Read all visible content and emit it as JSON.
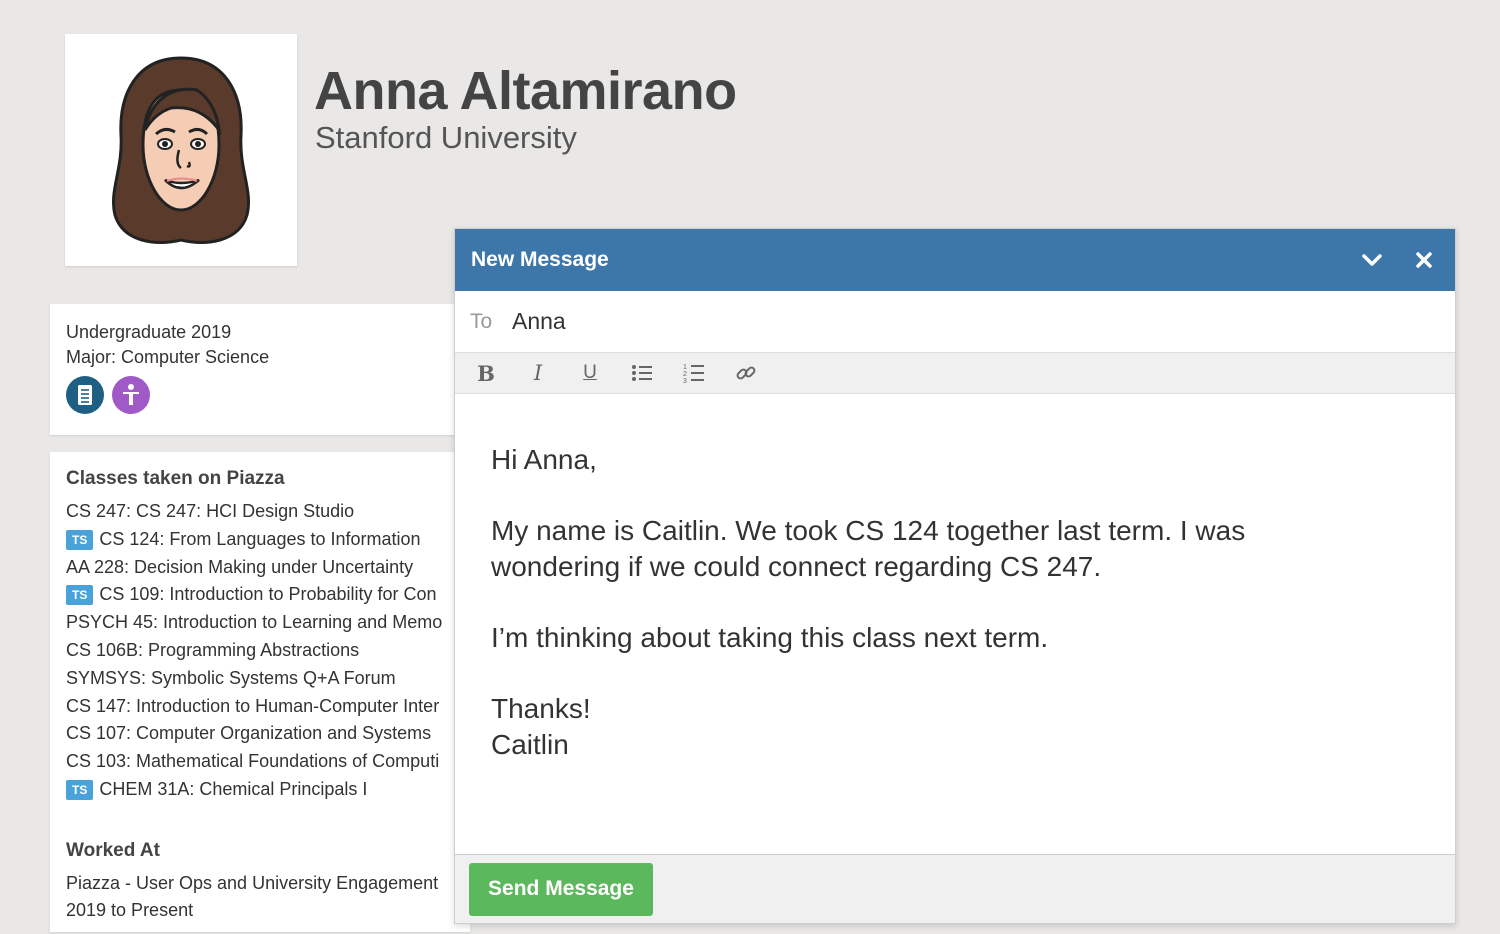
{
  "profile": {
    "name": "Anna Altamirano",
    "school": "Stanford University"
  },
  "info": {
    "year": "Undergraduate 2019",
    "major": "Major: Computer Science",
    "badges": [
      "book-icon",
      "accessibility-icon"
    ]
  },
  "classes": {
    "title": "Classes taken on Piazza",
    "tag_label": "TS",
    "items": [
      {
        "label": "CS 247: CS 247: HCI Design Studio",
        "ts": false
      },
      {
        "label": "CS 124: From Languages to Information",
        "ts": true
      },
      {
        "label": "AA 228: Decision Making under Uncertainty",
        "ts": false
      },
      {
        "label": "CS 109: Introduction to Probability for Con",
        "ts": true
      },
      {
        "label": "PSYCH 45: Introduction to Learning and Memo",
        "ts": false
      },
      {
        "label": "CS 106B: Programming Abstractions",
        "ts": false
      },
      {
        "label": "SYMSYS: Symbolic Systems Q+A Forum",
        "ts": false
      },
      {
        "label": "CS 147: Introduction to Human-Computer Inter",
        "ts": false
      },
      {
        "label": "CS 107: Computer Organization and Systems",
        "ts": false
      },
      {
        "label": "CS 103: Mathematical Foundations of Computi",
        "ts": false
      },
      {
        "label": "CHEM 31A: Chemical Principals I",
        "ts": true
      }
    ]
  },
  "work": {
    "title": "Worked At",
    "org": "Piazza - User Ops and University Engagement",
    "dates": "2019 to Present"
  },
  "compose": {
    "title": "New Message",
    "to_label": "To",
    "to_value": "Anna",
    "body": {
      "greeting": "Hi Anna,",
      "para1_line1": "My name is Caitlin. We took CS 124 together last term. I was",
      "para1_line2": "wondering if we could connect regarding CS 247.",
      "para2": "I’m thinking about taking this class next term.",
      "closing": "Thanks!",
      "signature": "Caitlin"
    },
    "send_label": "Send Message"
  },
  "colors": {
    "header_blue": "#3d76a9",
    "send_green": "#5cb85c",
    "ts_blue": "#4aa3d8"
  }
}
